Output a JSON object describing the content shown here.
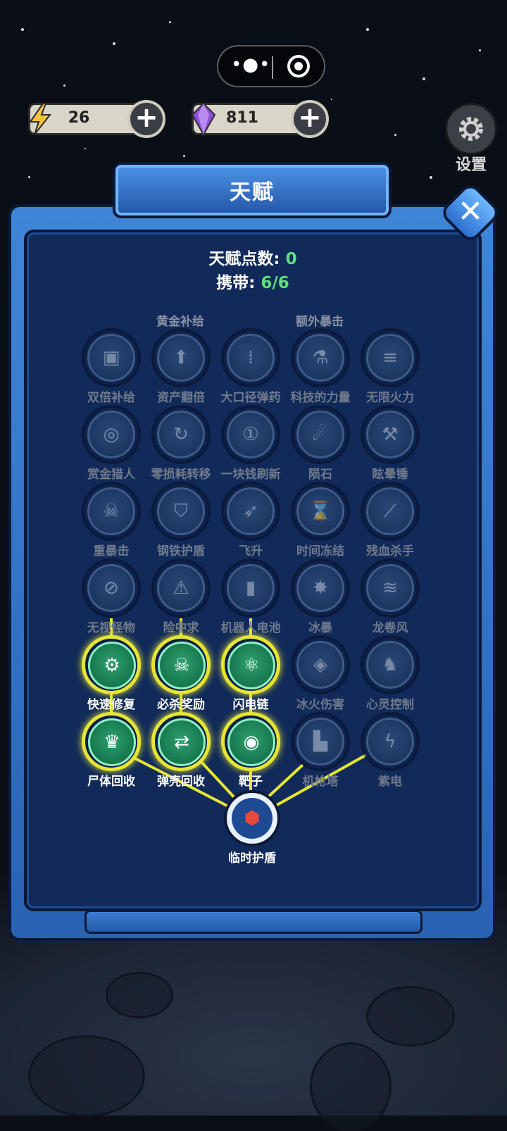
{
  "resources": {
    "energy": {
      "value": "26",
      "icon": "lightning-icon"
    },
    "gems": {
      "value": "811",
      "icon": "purple-gem-icon"
    }
  },
  "settings": {
    "label": "设置"
  },
  "panel": {
    "title": "天赋",
    "points_label": "天赋点数: ",
    "points_value": "0",
    "carry_label": "携带: ",
    "carry_value": "6/6"
  },
  "partial_headers": [
    "黄金补给",
    "额外暴击"
  ],
  "talents": [
    {
      "label": "双倍补给",
      "icon": "box-icon",
      "glyph": "▣",
      "active": false
    },
    {
      "label": "资产翻倍",
      "icon": "gold-bars-icon",
      "glyph": "⬆",
      "active": false
    },
    {
      "label": "大口径弹药",
      "icon": "bullets-icon",
      "glyph": "⁞",
      "active": false
    },
    {
      "label": "科技的力量",
      "icon": "flask-icon",
      "glyph": "⚗",
      "active": false
    },
    {
      "label": "无限火力",
      "icon": "gatling-icon",
      "glyph": "≡",
      "active": false
    },
    {
      "label": "赏金猎人",
      "icon": "coin-stack-icon",
      "glyph": "◎",
      "active": false
    },
    {
      "label": "零损耗转移",
      "icon": "cycle-icon",
      "glyph": "↻",
      "active": false
    },
    {
      "label": "一块钱刷新",
      "icon": "coin-icon",
      "glyph": "①",
      "active": false
    },
    {
      "label": "陨石",
      "icon": "meteor-icon",
      "glyph": "☄",
      "active": false
    },
    {
      "label": "眩晕锤",
      "icon": "hammer-icon",
      "glyph": "⚒",
      "active": false
    },
    {
      "label": "重暴击",
      "icon": "skull-target-icon",
      "glyph": "☠",
      "active": false
    },
    {
      "label": "钢铁护盾",
      "icon": "shield-icon",
      "glyph": "⛉",
      "active": false
    },
    {
      "label": "飞升",
      "icon": "rocket-icon",
      "glyph": "➶",
      "active": false
    },
    {
      "label": "时间冻结",
      "icon": "hourglass-icon",
      "glyph": "⌛",
      "active": false
    },
    {
      "label": "残血杀手",
      "icon": "knife-icon",
      "glyph": "⟋",
      "active": false
    },
    {
      "label": "无视怪物",
      "icon": "no-ghost-icon",
      "glyph": "⊘",
      "active": false
    },
    {
      "label": "险中求",
      "icon": "warning-icon",
      "glyph": "⚠",
      "active": false
    },
    {
      "label": "机器人电池",
      "icon": "battery-icon",
      "glyph": "▮",
      "active": false
    },
    {
      "label": "冰暴",
      "icon": "ice-burst-icon",
      "glyph": "✸",
      "active": false
    },
    {
      "label": "龙卷风",
      "icon": "tornado-icon",
      "glyph": "≋",
      "active": false
    },
    {
      "label": "快速修复",
      "icon": "wrench-gear-icon",
      "glyph": "⚙",
      "active": true
    },
    {
      "label": "必杀奖励",
      "icon": "skull-arrows-icon",
      "glyph": "☠",
      "active": true
    },
    {
      "label": "闪电链",
      "icon": "chain-nodes-icon",
      "glyph": "⚛",
      "active": true
    },
    {
      "label": "冰火伤害",
      "icon": "ice-fire-icon",
      "glyph": "◈",
      "active": false
    },
    {
      "label": "心灵控制",
      "icon": "mind-control-icon",
      "glyph": "♞",
      "active": false
    },
    {
      "label": "尸体回收",
      "icon": "money-bag-icon",
      "glyph": "♛",
      "active": true
    },
    {
      "label": "弹壳回收",
      "icon": "shell-recycle-icon",
      "glyph": "⇄",
      "active": true
    },
    {
      "label": "靶子",
      "icon": "target-icon",
      "glyph": "◉",
      "active": true
    },
    {
      "label": "机枪塔",
      "icon": "turret-icon",
      "glyph": "▙",
      "active": false
    },
    {
      "label": "紫电",
      "icon": "purple-lightning-icon",
      "glyph": "ϟ",
      "active": false
    }
  ],
  "root": {
    "label": "临时护盾",
    "icon": "hex-shield-icon",
    "glyph": "⬢"
  },
  "colors": {
    "link": "#e6e534",
    "active_ring": "#e6e534",
    "panel": "#112a5a",
    "accent_green": "#5fe07a"
  }
}
